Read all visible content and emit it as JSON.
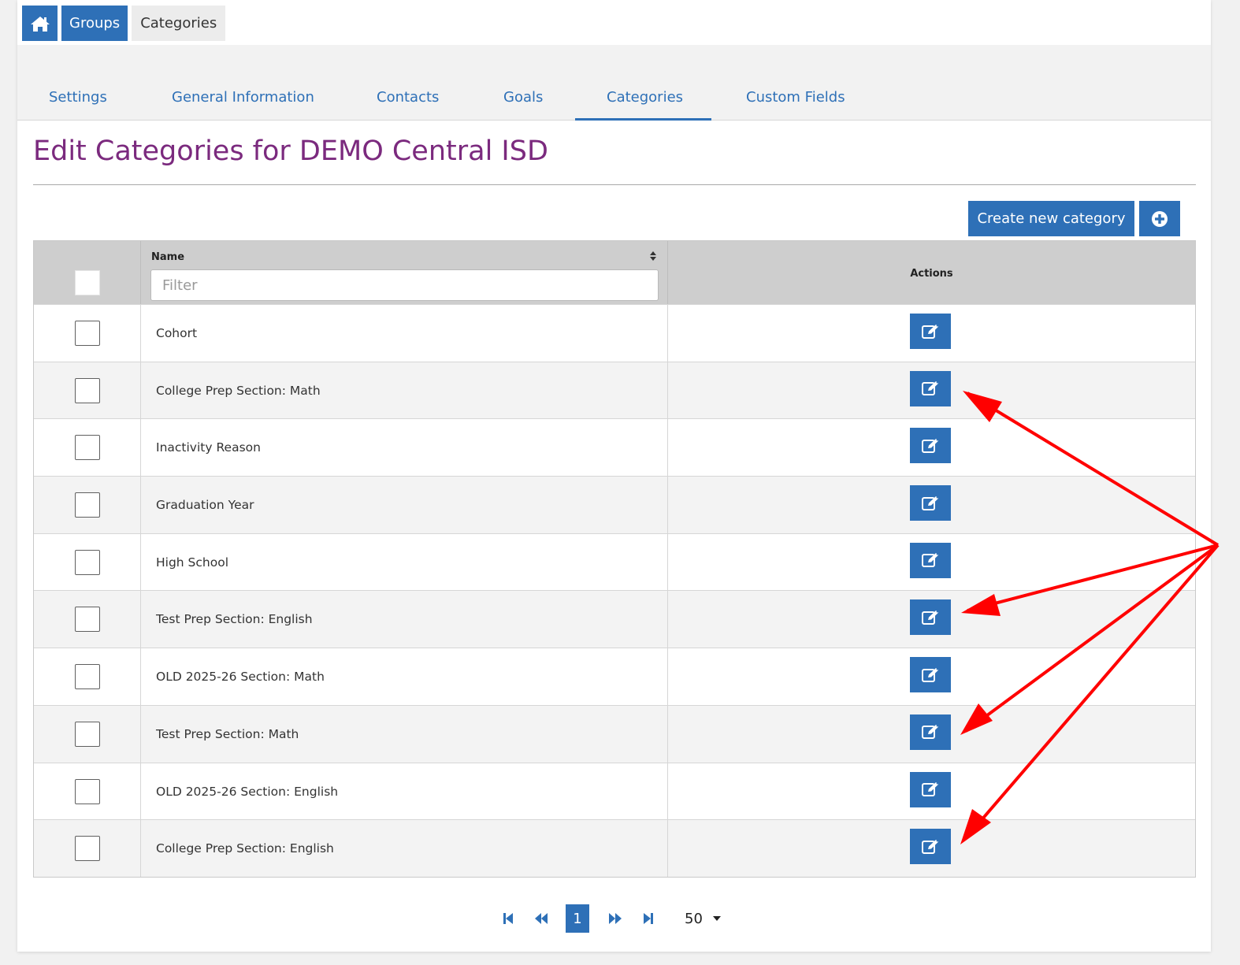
{
  "breadcrumb": {
    "home_icon": "home-icon",
    "groups": "Groups",
    "current": "Categories"
  },
  "tabs": [
    "Settings",
    "General Information",
    "Contacts",
    "Goals",
    "Categories",
    "Custom Fields"
  ],
  "active_tab": "Categories",
  "title": "Edit Categories for DEMO Central ISD",
  "create_button": "Create new category",
  "plus_icon": "plus-circle-icon",
  "table": {
    "name_header": "Name",
    "filter_placeholder": "Filter",
    "actions_header": "Actions",
    "rows": [
      {
        "name": "Cohort"
      },
      {
        "name": "College Prep Section: Math"
      },
      {
        "name": "Inactivity Reason"
      },
      {
        "name": "Graduation Year"
      },
      {
        "name": "High School"
      },
      {
        "name": "Test Prep Section: English"
      },
      {
        "name": "OLD 2025-26 Section: Math"
      },
      {
        "name": "Test Prep Section: Math"
      },
      {
        "name": "OLD 2025-26 Section: English"
      },
      {
        "name": "College Prep Section: English"
      }
    ]
  },
  "pagination": {
    "current_page": "1",
    "page_size": "50"
  },
  "colors": {
    "primary": "#2e70b7",
    "title": "#7b2a7e",
    "annotation_arrow": "#ff0000"
  }
}
